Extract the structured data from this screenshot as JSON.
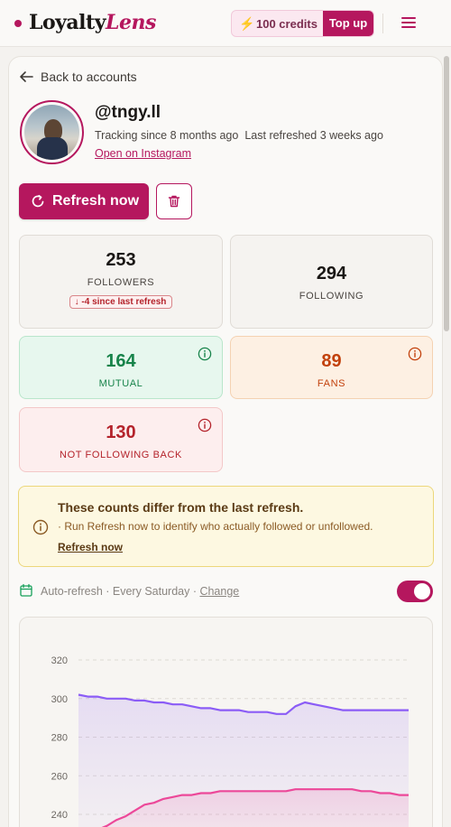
{
  "header": {
    "brand_main": "Loyalty",
    "brand_accent": "Lens",
    "credits_label": "100 credits",
    "topup_label": "Top up",
    "icons": {
      "bolt": "lightning-bolt-icon",
      "menu": "hamburger-menu-icon"
    }
  },
  "nav": {
    "back_label": "Back to accounts"
  },
  "profile": {
    "username": "@tngy.ll",
    "tracking": "Tracking since 8 months ago",
    "refreshed": "Last refreshed 3 weeks ago",
    "instagram_link": "Open on Instagram"
  },
  "actions": {
    "refresh_label": "Refresh now"
  },
  "stats": {
    "followers": {
      "value": "253",
      "label": "FOLLOWERS",
      "delta": "-4 since last refresh"
    },
    "following": {
      "value": "294",
      "label": "FOLLOWING"
    },
    "mutual": {
      "value": "164",
      "label": "MUTUAL"
    },
    "fans": {
      "value": "89",
      "label": "FANS"
    },
    "not_following_back": {
      "value": "130",
      "label": "NOT FOLLOWING BACK"
    }
  },
  "alert": {
    "title": "These counts differ from the last refresh.",
    "body": "· Run Refresh now to identify who actually followed or unfollowed.",
    "link": "Refresh now"
  },
  "auto_refresh": {
    "text": "Auto-refresh · Every Saturday · ",
    "change_label": "Change",
    "enabled": true
  },
  "colors": {
    "brand": "#b5175e",
    "mutual": "#17834a",
    "fans": "#c2410c",
    "not_following_back": "#b4232b",
    "following_line": "#8b5cf6",
    "followers_line": "#ec4899"
  },
  "chart_data": {
    "type": "area",
    "y_ticks": [
      320,
      300,
      280,
      260,
      240
    ],
    "ylim": [
      228,
      332
    ],
    "grid": true,
    "series": [
      {
        "color": "#8b5cf6",
        "values": [
          302,
          301,
          301,
          300,
          300,
          300,
          299,
          299,
          298,
          298,
          297,
          297,
          296,
          295,
          295,
          294,
          294,
          294,
          293,
          293,
          293,
          292,
          292,
          296,
          298,
          297,
          296,
          295,
          294,
          294,
          294,
          294,
          294,
          294,
          294,
          294
        ]
      },
      {
        "color": "#ec4899",
        "values": [
          229,
          230,
          232,
          234,
          237,
          239,
          242,
          245,
          246,
          248,
          249,
          250,
          250,
          251,
          251,
          252,
          252,
          252,
          252,
          252,
          252,
          252,
          252,
          253,
          253,
          253,
          253,
          253,
          253,
          253,
          252,
          252,
          251,
          251,
          250,
          250
        ]
      }
    ]
  }
}
